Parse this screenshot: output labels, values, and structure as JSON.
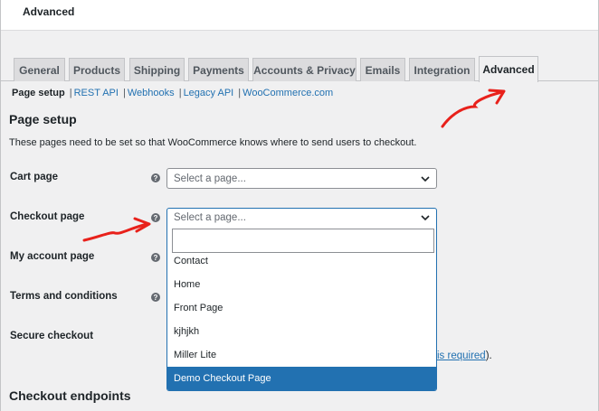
{
  "header": {
    "title": "Advanced"
  },
  "tabs": [
    {
      "label": "General",
      "active": false
    },
    {
      "label": "Products",
      "active": false
    },
    {
      "label": "Shipping",
      "active": false
    },
    {
      "label": "Payments",
      "active": false
    },
    {
      "label": "Accounts & Privacy",
      "active": false
    },
    {
      "label": "Emails",
      "active": false
    },
    {
      "label": "Integration",
      "active": false
    },
    {
      "label": "Advanced",
      "active": true
    }
  ],
  "subnav": {
    "current": "Page setup",
    "links": [
      "REST API",
      "Webhooks",
      "Legacy API",
      "WooCommerce.com"
    ],
    "separator": "|"
  },
  "section": {
    "title": "Page setup",
    "description": "These pages need to be set so that WooCommerce knows where to send users to checkout."
  },
  "fields": {
    "cart_page": {
      "label": "Cart page",
      "placeholder": "Select a page..."
    },
    "checkout_page": {
      "label": "Checkout page",
      "placeholder": "Select a page..."
    },
    "my_account_page": {
      "label": "My account page"
    },
    "terms_and_conditions": {
      "label": "Terms and conditions"
    },
    "secure_checkout": {
      "label": "Secure checkout",
      "notice_link": "is required",
      "notice_suffix": ")."
    }
  },
  "dropdown": {
    "search_value": "",
    "options": [
      "Contact",
      "Home",
      "Front Page",
      "kjhjkh",
      "Miller Lite",
      "Demo Checkout Page"
    ],
    "highlighted_index": 5
  },
  "next_section": {
    "title": "Checkout endpoints"
  },
  "help_glyph": "?",
  "colors": {
    "link": "#2271b1",
    "highlight": "#2271b1",
    "annotation_arrow": "#e8211b",
    "background": "#f0f0f1"
  },
  "icons": {
    "help": "question-circle-icon",
    "select_caret": "chevron-down-icon",
    "annotation": "red-arrow-annotation"
  }
}
